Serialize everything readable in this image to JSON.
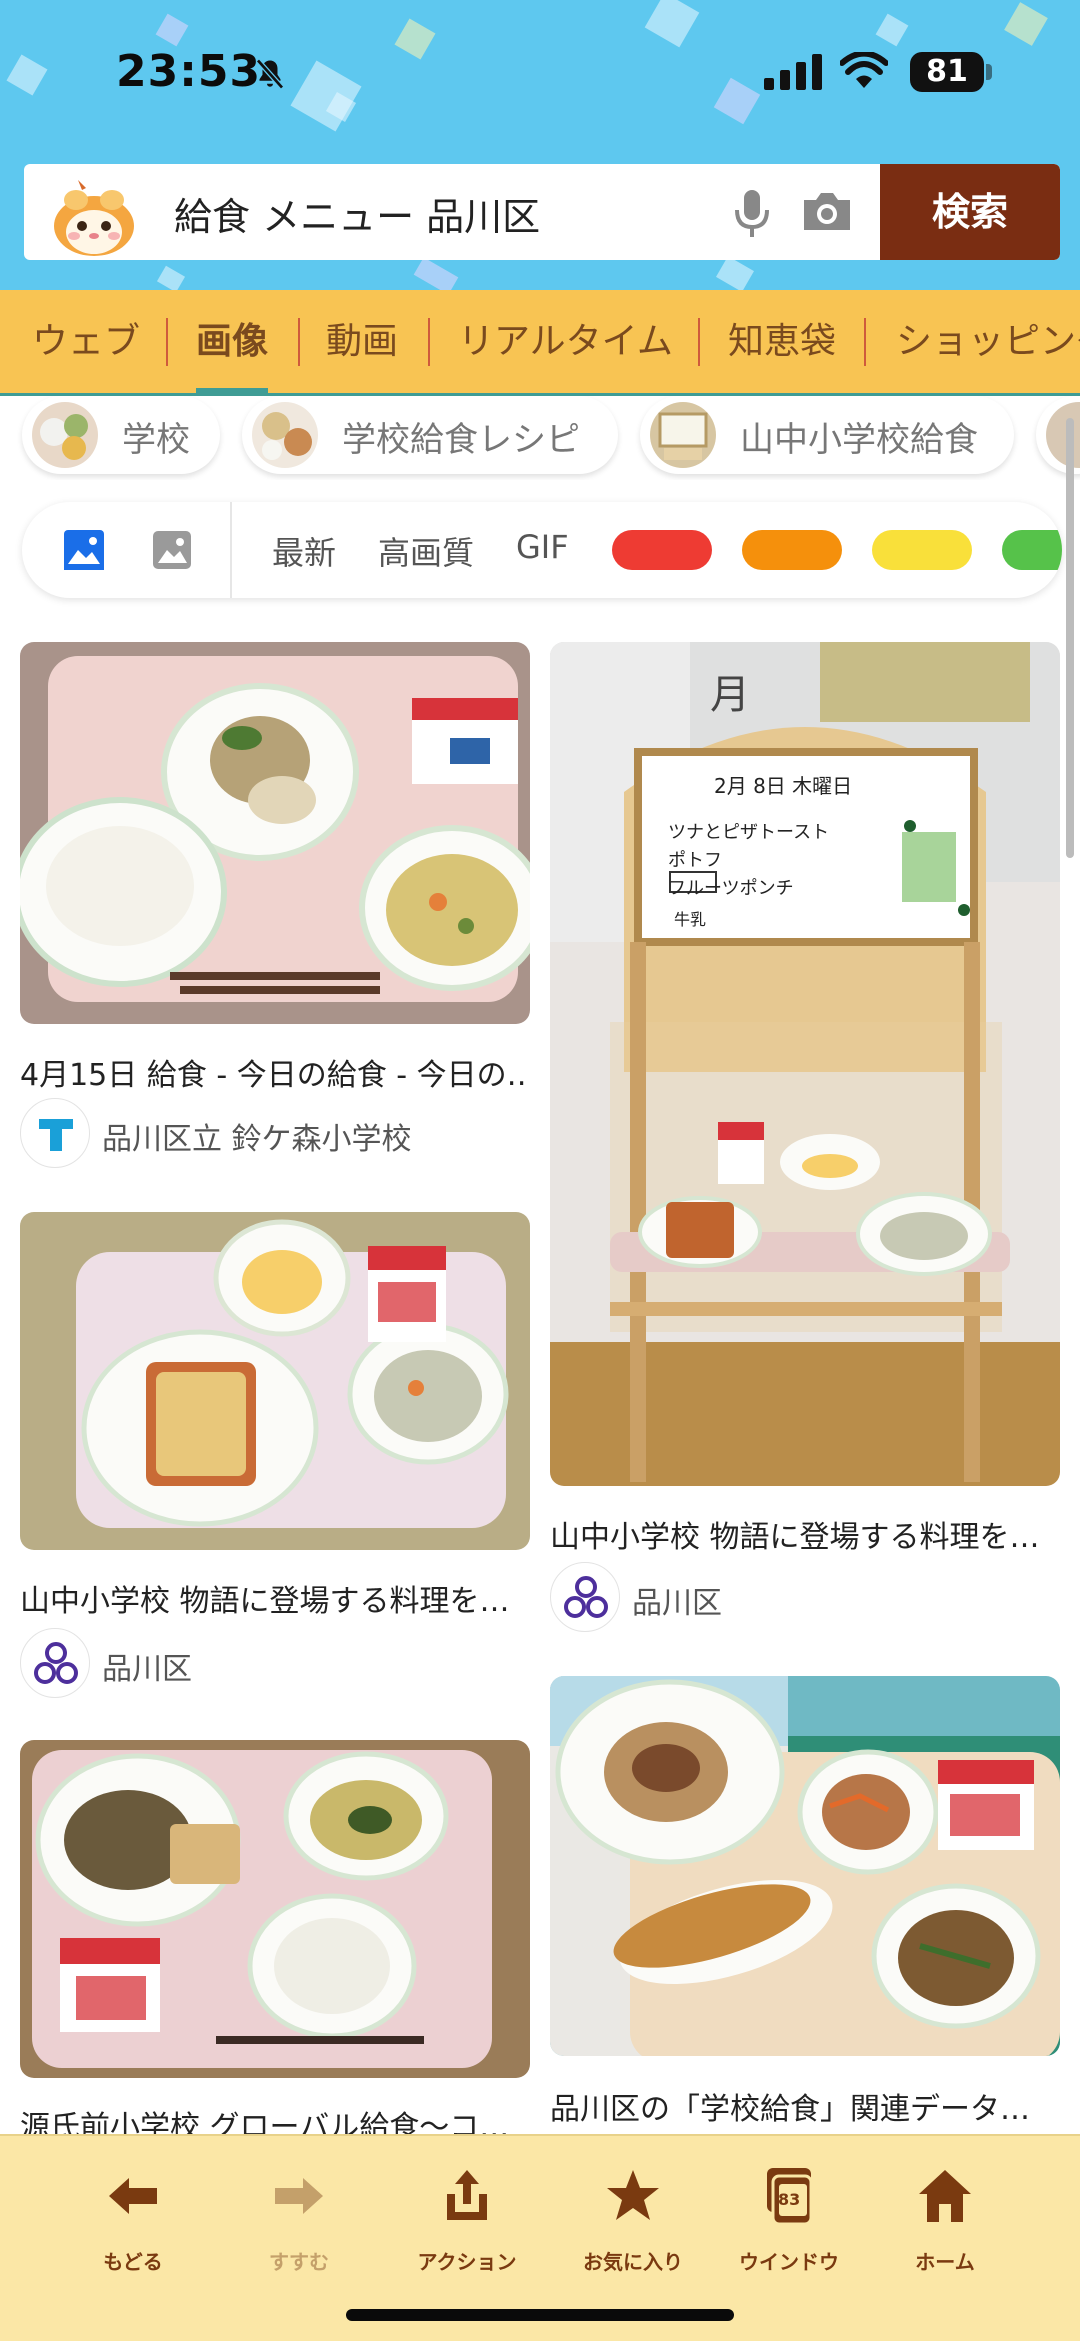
{
  "status_bar": {
    "time": "23:53",
    "battery": "81",
    "icons": [
      "bell-off-icon",
      "signal-icon",
      "wifi-icon",
      "battery-icon"
    ]
  },
  "search": {
    "query": "給食 メニュー 品川区",
    "button_label": "検索",
    "mascot": "guinea-pig-mascot",
    "icons": [
      "mic-icon",
      "camera-icon"
    ]
  },
  "tabs": [
    "ウェブ",
    "画像",
    "動画",
    "リアルタイム",
    "知恵袋",
    "ショッピング"
  ],
  "active_tab": "画像",
  "related_chips": [
    "学校",
    "学校給食レシピ",
    "山中小学校給食"
  ],
  "filters": {
    "icons": [
      "image-filled-icon",
      "image-outline-icon"
    ],
    "options": [
      "最新",
      "高画質",
      "GIF"
    ],
    "color_swatches": [
      "#ee3b33",
      "#f5900c",
      "#f9e03a",
      "#56c24a"
    ]
  },
  "results": [
    {
      "title": "4月15日 給食 - 今日の給食 - 今日の…",
      "source": "品川区立 鈴ケ森小学校",
      "source_icon": "t-logo-icon"
    },
    {
      "title": "山中小学校 物語に登場する料理を…",
      "source": "品川区",
      "source_icon": "shinagawa-logo-icon"
    },
    {
      "title": "源氏前小学校 グローバル給食〜コ…",
      "source": "",
      "source_icon": ""
    },
    {
      "title": "山中小学校 物語に登場する料理を…",
      "source": "品川区",
      "source_icon": "shinagawa-logo-icon"
    },
    {
      "title": "品川区の「学校給食」関連データ…",
      "source": "",
      "source_icon": ""
    }
  ],
  "whiteboard": {
    "header": "月",
    "date": "2月 8日 木曜日",
    "lines": [
      "ツナとピザトースト",
      "ポトフ",
      "フルーツポンチ",
      "牛乳"
    ]
  },
  "milk_label": "牛乳",
  "toolbar": {
    "items": [
      {
        "label": "もどる",
        "icon": "back-arrow-icon"
      },
      {
        "label": "すすむ",
        "icon": "forward-arrow-icon"
      },
      {
        "label": "アクション",
        "icon": "share-icon"
      },
      {
        "label": "お気に入り",
        "icon": "star-icon"
      },
      {
        "label": "ウインドウ",
        "icon": "windows-icon",
        "count": "83"
      },
      {
        "label": "ホーム",
        "icon": "home-icon"
      }
    ]
  }
}
